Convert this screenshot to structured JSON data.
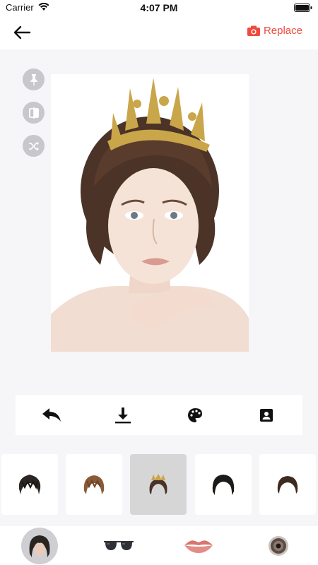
{
  "status_bar": {
    "carrier": "Carrier",
    "time": "4:07 PM"
  },
  "top_bar": {
    "replace_label": "Replace"
  },
  "colors": {
    "accent": "#f04a3e",
    "tool_gray": "#c8c8cc",
    "selected_bg": "#d6d6d6"
  },
  "side_tools": [
    {
      "icon": "pin-icon"
    },
    {
      "icon": "compare-icon"
    },
    {
      "icon": "shuffle-icon"
    }
  ],
  "actions": [
    {
      "icon": "undo-icon"
    },
    {
      "icon": "download-icon"
    },
    {
      "icon": "palette-icon"
    },
    {
      "icon": "portrait-icon"
    }
  ],
  "hairstyles": [
    {
      "icon": "black-messy-hair-icon",
      "selected": false
    },
    {
      "icon": "brown-shaggy-hair-icon",
      "selected": false
    },
    {
      "icon": "crown-updo-hair-icon",
      "selected": true
    },
    {
      "icon": "black-bob-hair-icon",
      "selected": false
    },
    {
      "icon": "dark-brown-short-hair-icon",
      "selected": false
    }
  ],
  "categories": [
    {
      "icon": "hair-category-icon",
      "active": true
    },
    {
      "icon": "sunglasses-category-icon",
      "active": false
    },
    {
      "icon": "lips-category-icon",
      "active": false
    },
    {
      "icon": "contact-lens-category-icon",
      "active": false
    }
  ]
}
